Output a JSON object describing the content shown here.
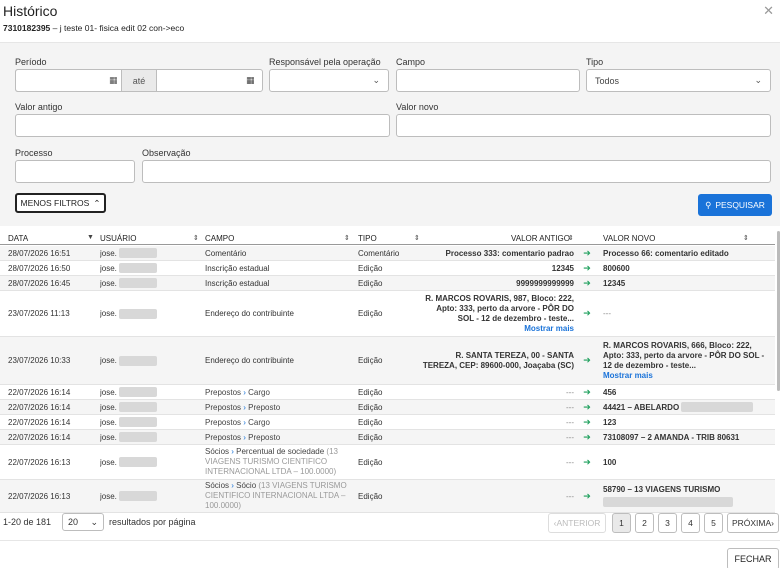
{
  "header": {
    "title": "Histórico",
    "subtitle_id": "7310182395",
    "subtitle_rest": " – j teste 01- fisica edit 02 con->eco"
  },
  "filters": {
    "periodo_label": "Período",
    "ate_label": "até",
    "responsavel_label": "Responsável pela operação",
    "campo_label": "Campo",
    "tipo_label": "Tipo",
    "tipo_value": "Todos",
    "valor_antigo_label": "Valor antigo",
    "valor_novo_label": "Valor novo",
    "processo_label": "Processo",
    "observacao_label": "Observação",
    "less_filters_label": "MENOS FILTROS",
    "search_label": "PESQUISAR"
  },
  "table": {
    "columns": [
      "DATA",
      "USUÁRIO",
      "CAMPO",
      "TIPO",
      "VALOR ANTIGO",
      "VALOR NOVO"
    ],
    "rows": [
      {
        "date": "28/07/2026 16:51",
        "user": "jose.",
        "campo": "Comentário",
        "tipo": "Comentário",
        "old": "Processo 333: comentario padrao",
        "new": "Processo 66: comentario editado"
      },
      {
        "date": "28/07/2026 16:50",
        "user": "jose.",
        "campo": "Inscrição estadual",
        "tipo": "Edição",
        "old": "12345",
        "new": "800600"
      },
      {
        "date": "28/07/2026 16:45",
        "user": "jose.",
        "campo": "Inscrição estadual",
        "tipo": "Edição",
        "old": "9999999999999",
        "new": "12345"
      },
      {
        "date": "23/07/2026 11:13",
        "user": "jose.",
        "campo": "Endereço do contribuinte",
        "tipo": "Edição",
        "old": "R. MARCOS ROVARIS, 987, Bloco: 222, Apto: 333, perto da arvore - PÔR DO SOL - 12 de dezembro - teste...",
        "old_more": "Mostrar mais",
        "new": "---"
      },
      {
        "date": "23/07/2026 10:33",
        "user": "jose.",
        "campo": "Endereço do contribuinte",
        "tipo": "Edição",
        "old": "R. SANTA TEREZA, 00 - SANTA TEREZA, CEP: 89600-000, Joaçaba (SC)",
        "new": "R. MARCOS ROVARIS, 666, Bloco: 222, Apto: 333, perto da arvore - PÔR DO SOL - 12 de dezembro - teste...",
        "new_more": "Mostrar mais"
      },
      {
        "date": "22/07/2026 16:14",
        "user": "jose.",
        "campo_a": "Prepostos",
        "campo_b": "Cargo",
        "tipo": "Edição",
        "old": "---",
        "new": "456"
      },
      {
        "date": "22/07/2026 16:14",
        "user": "jose.",
        "campo_a": "Prepostos",
        "campo_b": "Preposto",
        "tipo": "Edição",
        "old": "---",
        "new": "44421 – ABELARDO"
      },
      {
        "date": "22/07/2026 16:14",
        "user": "jose.",
        "campo_a": "Prepostos",
        "campo_b": "Cargo",
        "tipo": "Edição",
        "old": "---",
        "new": "123"
      },
      {
        "date": "22/07/2026 16:14",
        "user": "jose.",
        "campo_a": "Prepostos",
        "campo_b": "Preposto",
        "tipo": "Edição",
        "old": "---",
        "new": "73108097 – 2 AMANDA - TRIB 80631"
      },
      {
        "date": "22/07/2026 16:13",
        "user": "jose.",
        "campo_a": "Sócios",
        "campo_b": "Percentual de sociedade",
        "campo_c": "(13 VIAGENS TURISMO CIENTIFICO INTERNACIONAL LTDA – 100.0000)",
        "tipo": "Edição",
        "old": "---",
        "new": "100"
      },
      {
        "date": "22/07/2026 16:13",
        "user": "jose.",
        "campo_a": "Sócios",
        "campo_b": "Sócio",
        "campo_c": "(13 VIAGENS TURISMO CIENTIFICO INTERNACIONAL LTDA – 100.0000)",
        "tipo": "Edição",
        "old": "---",
        "new": "58790 – 13 VIAGENS TURISMO"
      }
    ]
  },
  "pagination": {
    "range": "1-20 de 181",
    "per_page": "20",
    "per_page_suffix": "resultados por página",
    "prev": "ANTERIOR",
    "pages": [
      "1",
      "2",
      "3",
      "4",
      "5"
    ],
    "next": "PRÓXIMA"
  },
  "footer": {
    "close_label": "FECHAR"
  },
  "icons": {
    "calendar": "calendar-icon",
    "search": "search-icon",
    "close": "close-icon",
    "arrow": "arrow-right-icon"
  },
  "colors": {
    "accent": "#1a73d9",
    "arrow": "#1ea05c"
  }
}
